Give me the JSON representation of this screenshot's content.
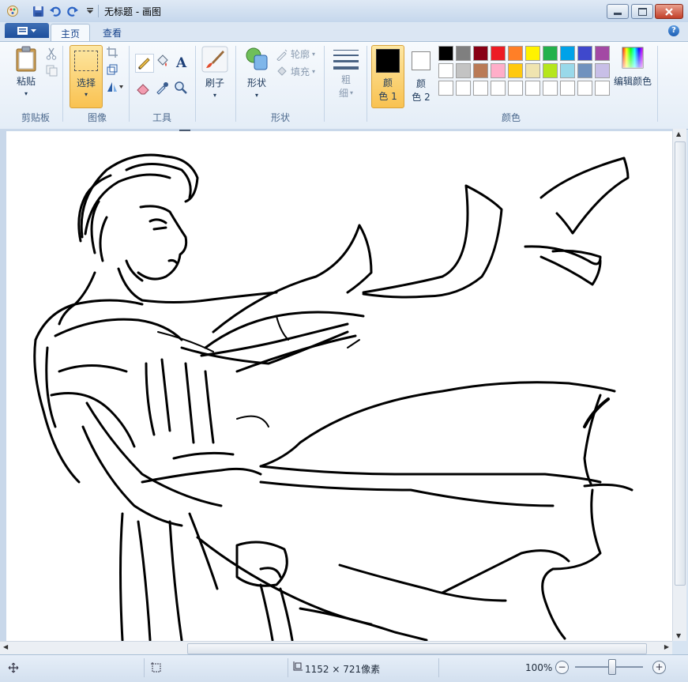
{
  "window": {
    "title": "无标题 - 画图"
  },
  "tabs": [
    {
      "label": "主页",
      "active": true
    },
    {
      "label": "查看",
      "active": false
    }
  ],
  "ribbon": {
    "clipboard": {
      "paste_label": "粘贴",
      "group_label": "剪贴板"
    },
    "image": {
      "select_label": "选择",
      "group_label": "图像"
    },
    "tools": {
      "group_label": "工具"
    },
    "brushes": {
      "label": "刷子"
    },
    "shapes": {
      "shapes_label": "形状",
      "outline_label": "轮廓",
      "fill_label": "填充",
      "group_label": "形状"
    },
    "size": {
      "label_line1": "粗",
      "label_line2": "细"
    },
    "colors": {
      "color1_line1": "颜",
      "color1_line2": "色 1",
      "color2_line1": "颜",
      "color2_line2": "色 2",
      "edit_label": "编辑颜色",
      "group_label": "颜色",
      "color1": "#000000",
      "color2": "#ffffff",
      "palette_row1": [
        "#000000",
        "#7f7f7f",
        "#880015",
        "#ed1c24",
        "#ff7f27",
        "#fff200",
        "#22b14c",
        "#00a2e8",
        "#3f48cc",
        "#a349a4"
      ],
      "palette_row2": [
        "#ffffff",
        "#c3c3c3",
        "#b97a57",
        "#ffaec9",
        "#ffc90e",
        "#efe4b0",
        "#b5e61d",
        "#99d9ea",
        "#7092be",
        "#c8bfe7"
      ],
      "palette_row3": [
        "#ffffff",
        "#ffffff",
        "#ffffff",
        "#ffffff",
        "#ffffff",
        "#ffffff",
        "#ffffff",
        "#ffffff",
        "#ffffff",
        "#ffffff"
      ]
    }
  },
  "statusbar": {
    "dimensions": "1152 × 721像素",
    "zoom": "100%"
  }
}
